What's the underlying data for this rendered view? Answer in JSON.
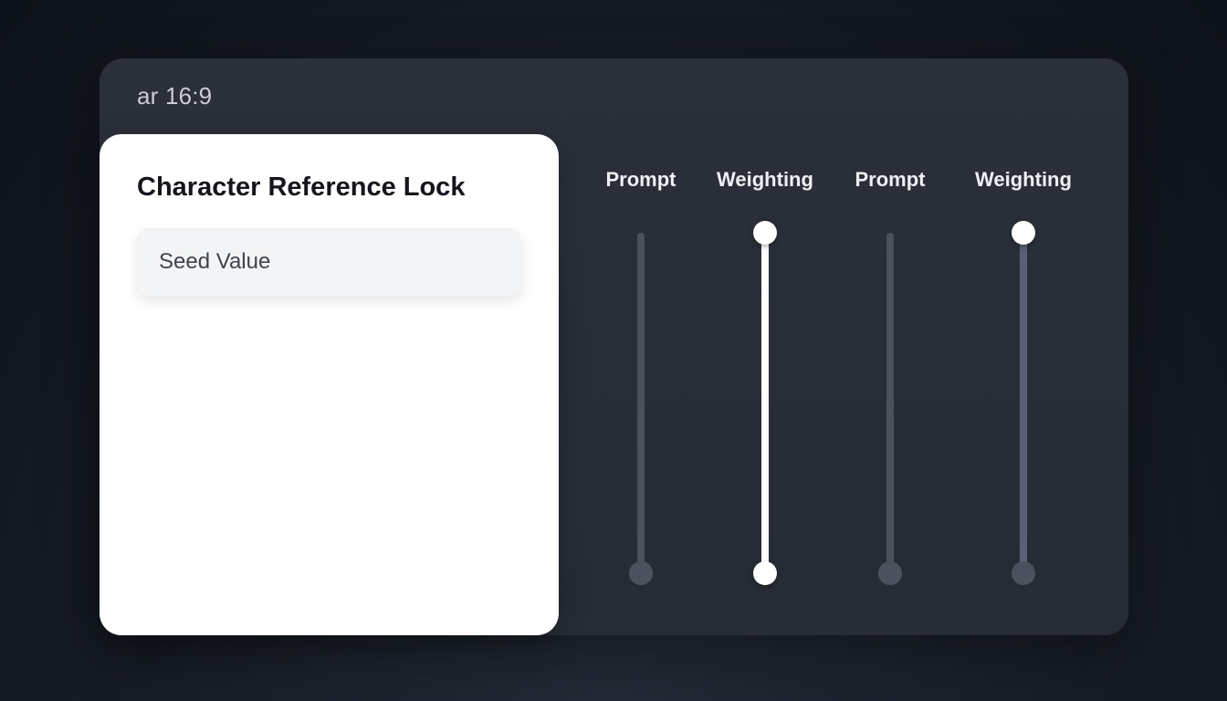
{
  "header": {
    "aspect_ratio": "ar 16:9"
  },
  "card": {
    "title": "Character Reference Lock",
    "seed_field": {
      "value": "Seed Value"
    }
  },
  "sliders": [
    {
      "label": "Prompt",
      "level": 0.0,
      "active": false,
      "style": "none"
    },
    {
      "label": "Weighting",
      "level": 1.0,
      "active": true,
      "style": "bright"
    },
    {
      "label": "Prompt",
      "level": 0.0,
      "active": false,
      "style": "none"
    },
    {
      "label": "Weighting",
      "level": 1.0,
      "active": true,
      "style": "dim"
    }
  ],
  "colors": {
    "background": "#161b25",
    "panel": "#282d37",
    "card": "#ffffff",
    "accent": "#ffffff",
    "track": "#4a505c"
  }
}
